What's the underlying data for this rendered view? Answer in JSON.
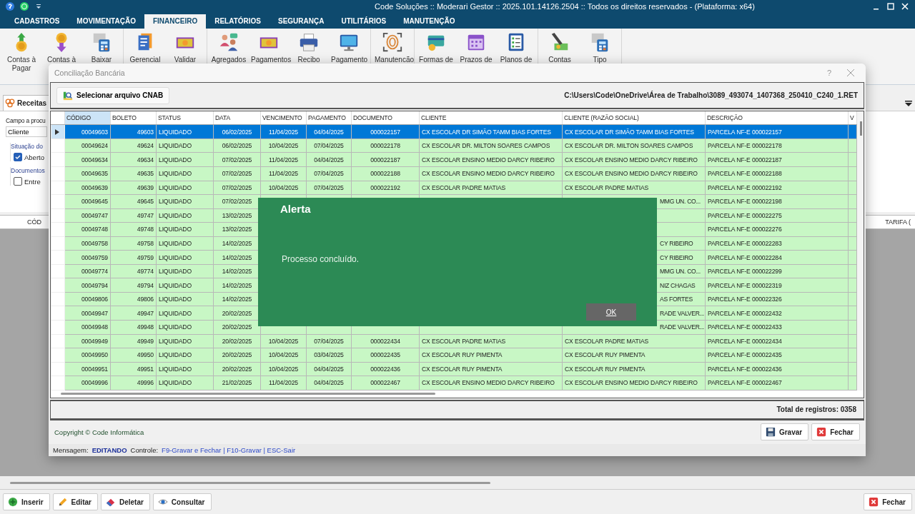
{
  "app": {
    "title": "Code Soluções :: Moderari Gestor :: 2025.101.14126.2504 :: Todos os direitos reservados - (Plataforma: x64)",
    "menu": [
      {
        "label": "CADASTROS",
        "selected": false
      },
      {
        "label": "MOVIMENTAÇÃO",
        "selected": false
      },
      {
        "label": "FINANCEIRO",
        "selected": true
      },
      {
        "label": "RELATÓRIOS",
        "selected": false
      },
      {
        "label": "SEGURANÇA",
        "selected": false
      },
      {
        "label": "UTILITÁRIOS",
        "selected": false
      },
      {
        "label": "MANUTENÇÃO",
        "selected": false
      }
    ],
    "ribbon": [
      {
        "items": [
          {
            "label": "Contas à Pagar"
          },
          {
            "label": "Contas à"
          },
          {
            "label": "Baixar"
          }
        ]
      },
      {
        "items": [
          {
            "label": "Gerencial"
          },
          {
            "label": "Validar"
          }
        ]
      },
      {
        "items": [
          {
            "label": "Agregados"
          },
          {
            "label": "Pagamentos"
          },
          {
            "label": "Recibo"
          },
          {
            "label": "Pagamento"
          }
        ]
      },
      {
        "items": [
          {
            "label": "Manutencão"
          }
        ]
      },
      {
        "items": [
          {
            "label": "Formas de"
          },
          {
            "label": "Prazos de"
          },
          {
            "label": "Planos de"
          }
        ]
      },
      {
        "items": [
          {
            "label": "Contas"
          },
          {
            "label": "Tipo"
          }
        ]
      }
    ]
  },
  "background": {
    "tab": {
      "label": "Receitas",
      "selected": true
    },
    "search_label": "Campo a procu",
    "search_field": {
      "value": "Cliente"
    },
    "groups": [
      {
        "title": "Situação do",
        "checkbox": {
          "label": "Aberto",
          "checked": true
        }
      },
      {
        "title": "Documentos",
        "checkbox": {
          "label": "Entre",
          "checked": false
        }
      }
    ],
    "grid_columns": [
      "CÓD",
      "TARIFA ("
    ],
    "buttons": [
      {
        "kind": "insert",
        "label": "Inserir"
      },
      {
        "kind": "edit",
        "label": "Editar"
      },
      {
        "kind": "delete",
        "label": "Deletar"
      },
      {
        "kind": "view",
        "label": "Consultar"
      }
    ],
    "close_button": {
      "label": "Fechar"
    }
  },
  "dialog": {
    "title": "Conciliação Bancária",
    "help": "?",
    "select_button": "Selecionar arquivo CNAB",
    "file_path": "C:\\Users\\Code\\OneDrive\\Área de Trabalho\\3089_493074_1407368_250410_C240_1.RET",
    "columns": [
      "CÓDIGO",
      "BOLETO",
      "STATUS",
      "DATA",
      "VENCIMENTO",
      "PAGAMENTO",
      "DOCUMENTO",
      "CLIENTE",
      "CLIENTE (RAZÃO SOCIAL)",
      "DESCRIÇÃO",
      "V"
    ],
    "rows": [
      {
        "selected": true,
        "codigo": "00049603",
        "boleto": "49603",
        "status": "LIQUIDADO",
        "data": "06/02/2025",
        "vencimento": "11/04/2025",
        "pagamento": "04/04/2025",
        "documento": "000022157",
        "cliente": "CX ESCOLAR DR SIMÃO TAMM BIAS FORTES",
        "razao": "CX ESCOLAR DR SIMÃO TAMM BIAS FORTES",
        "descricao": "PARCELA NF-E 000022157"
      },
      {
        "selected": false,
        "codigo": "00049624",
        "boleto": "49624",
        "status": "LIQUIDADO",
        "data": "06/02/2025",
        "vencimento": "10/04/2025",
        "pagamento": "07/04/2025",
        "documento": "000022178",
        "cliente": "CX ESCOLAR DR. MILTON SOARES CAMPOS",
        "razao": "CX ESCOLAR DR. MILTON SOARES CAMPOS",
        "descricao": "PARCELA NF-E 000022178"
      },
      {
        "selected": false,
        "codigo": "00049634",
        "boleto": "49634",
        "status": "LIQUIDADO",
        "data": "07/02/2025",
        "vencimento": "11/04/2025",
        "pagamento": "04/04/2025",
        "documento": "000022187",
        "cliente": "CX ESCOLAR ENSINO MEDIO DARCY RIBEIRO",
        "razao": "CX ESCOLAR ENSINO MEDIO DARCY RIBEIRO",
        "descricao": "PARCELA NF-E 000022187"
      },
      {
        "selected": false,
        "codigo": "00049635",
        "boleto": "49635",
        "status": "LIQUIDADO",
        "data": "07/02/2025",
        "vencimento": "11/04/2025",
        "pagamento": "07/04/2025",
        "documento": "000022188",
        "cliente": "CX ESCOLAR ENSINO MEDIO DARCY RIBEIRO",
        "razao": "CX ESCOLAR ENSINO MEDIO DARCY RIBEIRO",
        "descricao": "PARCELA NF-E 000022188"
      },
      {
        "selected": false,
        "codigo": "00049639",
        "boleto": "49639",
        "status": "LIQUIDADO",
        "data": "07/02/2025",
        "vencimento": "10/04/2025",
        "pagamento": "07/04/2025",
        "documento": "000022192",
        "cliente": "CX ESCOLAR PADRE MATIAS",
        "razao": "CX ESCOLAR PADRE MATIAS",
        "descricao": "PARCELA NF-E 000022192"
      },
      {
        "selected": false,
        "codigo": "00049645",
        "boleto": "49645",
        "status": "LIQUIDADO",
        "data": "07/02/2025",
        "razao": "MMG UN. CO...",
        "descricao": "PARCELA NF-E 000022198"
      },
      {
        "selected": false,
        "codigo": "00049747",
        "boleto": "49747",
        "status": "LIQUIDADO",
        "data": "13/02/2025",
        "descricao": "PARCELA NF-E 000022275"
      },
      {
        "selected": false,
        "codigo": "00049748",
        "boleto": "49748",
        "status": "LIQUIDADO",
        "data": "13/02/2025",
        "descricao": "PARCELA NF-E 000022276"
      },
      {
        "selected": false,
        "codigo": "00049758",
        "boleto": "49758",
        "status": "LIQUIDADO",
        "data": "14/02/2025",
        "razao": "CY RIBEIRO",
        "descricao": "PARCELA NF-E 000022283"
      },
      {
        "selected": false,
        "codigo": "00049759",
        "boleto": "49759",
        "status": "LIQUIDADO",
        "data": "14/02/2025",
        "razao": "CY RIBEIRO",
        "descricao": "PARCELA NF-E 000022284"
      },
      {
        "selected": false,
        "codigo": "00049774",
        "boleto": "49774",
        "status": "LIQUIDADO",
        "data": "14/02/2025",
        "razao": "MMG UN. CO...",
        "descricao": "PARCELA NF-E 000022299"
      },
      {
        "selected": false,
        "codigo": "00049794",
        "boleto": "49794",
        "status": "LIQUIDADO",
        "data": "14/02/2025",
        "razao": "NIZ CHAGAS",
        "descricao": "PARCELA NF-E 000022319"
      },
      {
        "selected": false,
        "codigo": "00049806",
        "boleto": "49806",
        "status": "LIQUIDADO",
        "data": "14/02/2025",
        "razao": "AS FORTES",
        "descricao": "PARCELA NF-E 000022326"
      },
      {
        "selected": false,
        "codigo": "00049947",
        "boleto": "49947",
        "status": "LIQUIDADO",
        "data": "20/02/2025",
        "razao": "RADE VALVER...",
        "descricao": "PARCELA NF-E 000022432"
      },
      {
        "selected": false,
        "codigo": "00049948",
        "boleto": "49948",
        "status": "LIQUIDADO",
        "data": "20/02/2025",
        "razao": "RADE VALVER...",
        "descricao": "PARCELA NF-E 000022433"
      },
      {
        "selected": false,
        "codigo": "00049949",
        "boleto": "49949",
        "status": "LIQUIDADO",
        "data": "20/02/2025",
        "vencimento": "10/04/2025",
        "pagamento": "07/04/2025",
        "documento": "000022434",
        "cliente": "CX ESCOLAR PADRE MATIAS",
        "razao": "CX ESCOLAR PADRE MATIAS",
        "descricao": "PARCELA NF-E 000022434"
      },
      {
        "selected": false,
        "codigo": "00049950",
        "boleto": "49950",
        "status": "LIQUIDADO",
        "data": "20/02/2025",
        "vencimento": "10/04/2025",
        "pagamento": "03/04/2025",
        "documento": "000022435",
        "cliente": "CX ESCOLAR RUY PIMENTA",
        "razao": "CX ESCOLAR RUY PIMENTA",
        "descricao": "PARCELA NF-E 000022435"
      },
      {
        "selected": false,
        "codigo": "00049951",
        "boleto": "49951",
        "status": "LIQUIDADO",
        "data": "20/02/2025",
        "vencimento": "10/04/2025",
        "pagamento": "04/04/2025",
        "documento": "000022436",
        "cliente": "CX ESCOLAR RUY PIMENTA",
        "razao": "CX ESCOLAR RUY PIMENTA",
        "descricao": "PARCELA NF-E 000022436"
      },
      {
        "selected": false,
        "codigo": "00049996",
        "boleto": "49996",
        "status": "LIQUIDADO",
        "data": "21/02/2025",
        "vencimento": "11/04/2025",
        "pagamento": "04/04/2025",
        "documento": "000022467",
        "cliente": "CX ESCOLAR ENSINO MEDIO DARCY RIBEIRO",
        "razao": "CX ESCOLAR ENSINO MEDIO DARCY RIBEIRO",
        "descricao": "PARCELA NF-E 000022467"
      }
    ],
    "total": "Total de registros: 0358",
    "copyright": "Copyright © Code Informática",
    "buttons": [
      {
        "kind": "save",
        "label": "Gravar"
      },
      {
        "kind": "close",
        "label": "Fechar"
      }
    ],
    "status": {
      "message_label": "Mensagem:",
      "message": "EDITANDO",
      "control_label": "Controle:",
      "shortcuts": "F9-Gravar e Fechar | F10-Gravar | ESC-Sair"
    }
  },
  "alert": {
    "title": "Alerta",
    "message": "Processo concluído.",
    "button": "OK"
  }
}
